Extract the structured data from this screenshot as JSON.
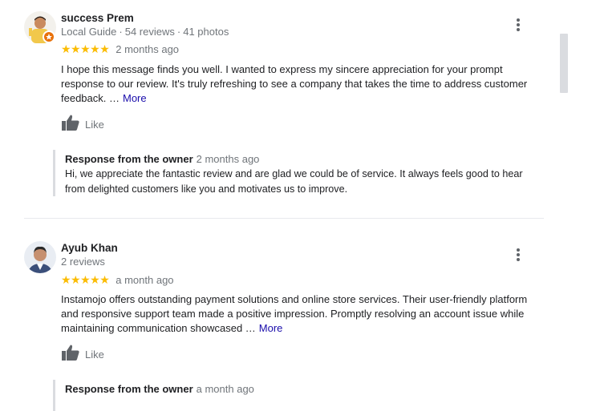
{
  "reviews": [
    {
      "reviewer_name": "success Prem",
      "meta": [
        "Local Guide",
        "54 reviews",
        "41 photos"
      ],
      "rating": 5,
      "stars_glyph": "★★★★★",
      "date": "2 months ago",
      "text": "I hope this message finds you well. I wanted to express my sincere appreciation for your prompt response to our review. It's truly refreshing to see a company that takes the time to address customer feedback. …",
      "more_label": "More",
      "like_label": "Like",
      "owner_response": {
        "title": "Response from the owner",
        "date": "2 months ago",
        "text": "Hi, we appreciate the fantastic review and are glad we could be of service. It always feels good to hear from delighted customers like you and motivates us to improve."
      }
    },
    {
      "reviewer_name": "Ayub Khan",
      "meta": [
        "2 reviews"
      ],
      "rating": 5,
      "stars_glyph": "★★★★★",
      "date": "a month ago",
      "text": "Instamojo offers outstanding payment solutions and online store services. Their user-friendly platform and responsive support team made a positive impression. Promptly resolving an account issue while maintaining communication showcased …",
      "more_label": "More",
      "like_label": "Like",
      "owner_response": {
        "title": "Response from the owner",
        "date": "a month ago",
        "text": ""
      }
    }
  ],
  "colors": {
    "star": "#fbbc04",
    "link": "#1a0dab",
    "secondary_text": "#70757a",
    "local_guide_badge": "#e8710a"
  },
  "icons": {
    "like": "thumbs-up-icon",
    "menu": "more-vert-icon",
    "badge": "local-guide-badge-icon"
  }
}
